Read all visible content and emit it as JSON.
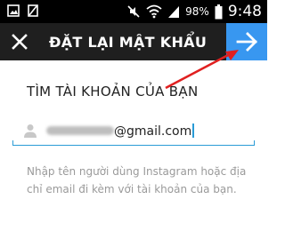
{
  "status_bar": {
    "clock": "9:48",
    "battery_percent": "98%",
    "icons": [
      "image-icon",
      "notification-off-icon",
      "mute-icon",
      "wifi-icon",
      "signal-icon",
      "battery-icon"
    ]
  },
  "action_bar": {
    "title": "ĐẶT LẠI MẬT KHẨU",
    "close_icon": "close-icon",
    "next_icon": "arrow-right-icon",
    "background": "#1f1f1f",
    "accent": "#3897f0"
  },
  "form": {
    "heading": "TÌM TÀI KHOẢN CỦA BẠN",
    "email_value_visible_suffix": "@gmail.com",
    "helper_text": "Nhập tên người dùng Instagram hoặc địa chỉ email đi kèm với tài khoản của bạn."
  },
  "annotation": {
    "arrow_color": "#e02020"
  }
}
